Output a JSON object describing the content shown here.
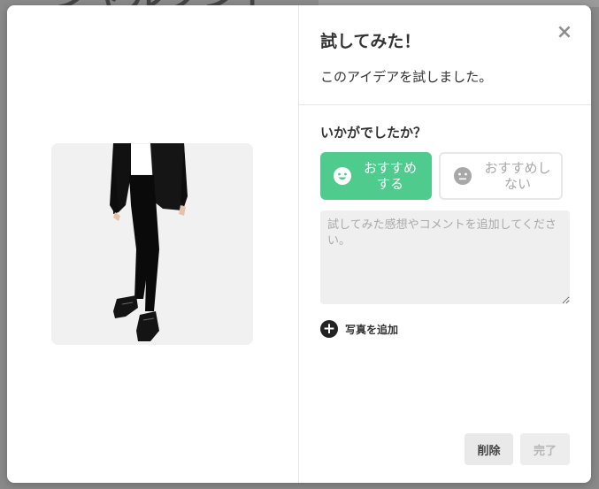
{
  "background": {
    "title": "ーシャルクンド"
  },
  "modal": {
    "title": "試してみた！",
    "description": "このアイデアを試しました。",
    "question": "いかがでしたか？",
    "recommend": {
      "label": "おすすめする",
      "color": "#4ecb8d"
    },
    "not_recommend": {
      "label": "おすすめしない"
    },
    "comment": {
      "placeholder": "試してみた感想やコメントを追加してください。",
      "value": ""
    },
    "add_photo": {
      "label": "写真を追加"
    },
    "buttons": {
      "delete": "削除",
      "done": "完了"
    },
    "close_icon": "×"
  },
  "icons": {
    "close": "close-icon",
    "smile": "smile-icon",
    "neutral": "neutral-face-icon",
    "plus": "plus-circle-icon"
  }
}
